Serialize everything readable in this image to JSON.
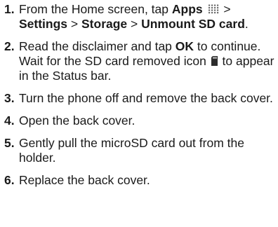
{
  "steps": [
    {
      "number": "1.",
      "parts": {
        "t1": "From the Home screen, tap ",
        "apps": "Apps",
        "t2": " > ",
        "settings": "Settings",
        "sep1": " > ",
        "storage": "Storage",
        "sep2": " > ",
        "unmount": "Unmount SD card",
        "end": "."
      },
      "icon": "apps-grid-icon"
    },
    {
      "number": "2.",
      "parts": {
        "t1": "Read the disclaimer and tap ",
        "ok": "OK",
        "t2": " to continue. Wait for the SD card removed icon ",
        "t3": " to appear in the Status bar."
      },
      "icon": "sd-card-removed-icon"
    },
    {
      "number": "3.",
      "text": "Turn the phone off and remove the back cover."
    },
    {
      "number": "4.",
      "text": "Open the back cover."
    },
    {
      "number": "5.",
      "text": "Gently pull the microSD card out from the holder."
    },
    {
      "number": "6.",
      "text": "Replace the back cover."
    }
  ],
  "colors": {
    "text": "#1a1a1a",
    "background": "#ffffff",
    "icon": "#6e6e6e"
  }
}
